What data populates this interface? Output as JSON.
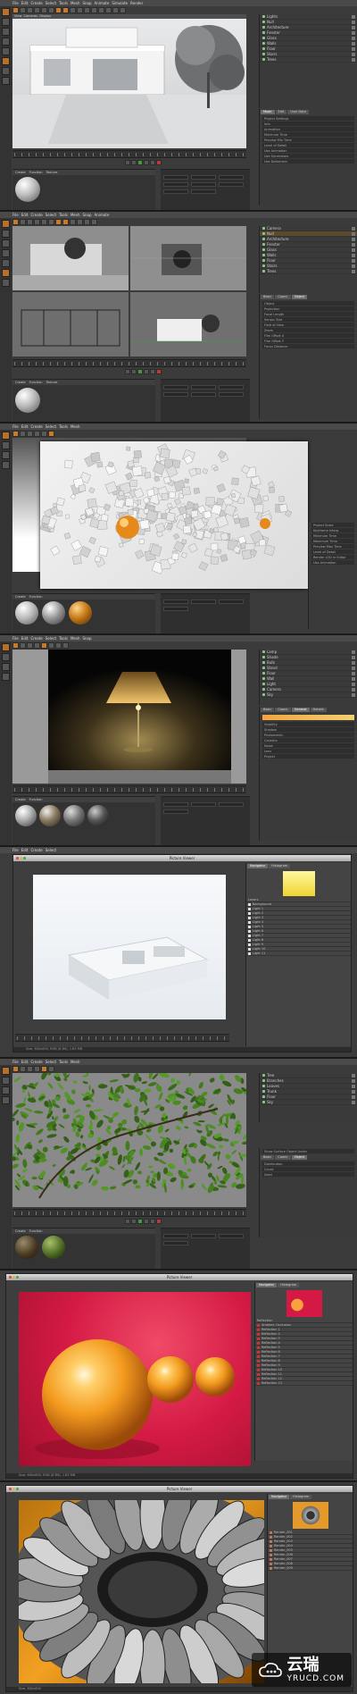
{
  "app": {
    "menu_items": [
      "File",
      "Edit",
      "Create",
      "Select",
      "Tools",
      "Mesh",
      "Snap",
      "Animate",
      "Simulate",
      "Render",
      "Sculpt",
      "Character",
      "Plugins",
      "Script",
      "Window",
      "Help"
    ],
    "viewport_menu": [
      "View",
      "Cameras",
      "Display",
      "Options",
      "Filter",
      "Panel"
    ],
    "material_menu": [
      "Create",
      "Function",
      "Texture"
    ],
    "attr_tabs": [
      "Mode",
      "Edit",
      "User Data"
    ],
    "object_tabs": [
      "Basic",
      "Coord.",
      "Object",
      "Phong"
    ]
  },
  "strips": [
    {
      "id": "s1",
      "objects": [
        "Lights",
        "Null",
        "Architecture",
        "Fenster",
        "Glass",
        "Walls",
        "Floor",
        "Stairs",
        "Trees"
      ],
      "fields": [
        "Project Settings",
        "Info",
        "Animation",
        "Minimum Time",
        "Preview Min Time",
        "Level of Detail",
        "Use Animation",
        "Use Generators",
        "Use Deformers"
      ],
      "frame": "0 F",
      "maxframe": "90 F"
    },
    {
      "id": "s2",
      "objects": [
        "Camera",
        "Null",
        "Architecture",
        "Fenster",
        "Glass",
        "Walls",
        "Floor",
        "Stairs",
        "Trees"
      ],
      "fields": [
        "Object",
        "Projection",
        "Focal Length",
        "Sensor Size",
        "Field of View",
        "Zoom",
        "Film Offset X",
        "Film Offset Y",
        "Focus Distance"
      ],
      "frame": "0 F",
      "maxframe": "90 F"
    },
    {
      "id": "s3",
      "objects": [
        "Camera",
        "Cubes",
        "Sphere",
        "Floor",
        "Light",
        "Sky"
      ],
      "fields": [
        "Project Scale",
        "Keyframe Interp.",
        "Minimum Time",
        "Maximum Time",
        "Preview Max Time",
        "Level of Detail",
        "Render LOD in Editor",
        "Use Animation"
      ],
      "frame": "0 F",
      "maxframe": "90 F"
    },
    {
      "id": "s4",
      "objects": [
        "Lamp",
        "Shade",
        "Bulb",
        "Stand",
        "Floor",
        "Wall",
        "Light",
        "Camera",
        "Sky"
      ],
      "fields": [
        "General",
        "Details",
        "Visibility",
        "Shadow",
        "Photometric",
        "Caustics",
        "Noise",
        "Lens",
        "Project"
      ],
      "frame": "0 F",
      "maxframe": "90 F"
    },
    {
      "id": "s5",
      "title": "Picture Viewer",
      "tabs": [
        "Navigator",
        "Histogram"
      ],
      "layers": [
        "Layers",
        "Background",
        "Light 1",
        "Light 2",
        "Light 3",
        "Light 4",
        "Light 5",
        "Light 6",
        "Light 7",
        "Light 8",
        "Light 9",
        "Light 10",
        "Light 11"
      ],
      "status": "Size: 800x600, RGB (8 Bit), 1.83 MB"
    },
    {
      "id": "s6",
      "objects": [
        "Tree",
        "Branches",
        "Leaves",
        "Trunk",
        "Floor",
        "Sky"
      ],
      "fields": [
        "Show Surface Object Under",
        "Basic",
        "Coord.",
        "Object",
        "Distribution",
        "Count",
        "Seed"
      ],
      "frame": "0 F",
      "maxframe": "90 F"
    },
    {
      "id": "s7",
      "title": "Picture Viewer",
      "tabs": [
        "Navigator",
        "Histogram"
      ],
      "layers": [
        "Reflection",
        "Ambient Occlusion",
        "Reflection 1",
        "Reflection 2",
        "Reflection 3",
        "Reflection 4",
        "Reflection 5",
        "Reflection 6",
        "Reflection 7",
        "Reflection 8",
        "Reflection 9",
        "Reflection 10",
        "Reflection 11",
        "Reflection 12",
        "Reflection 13"
      ],
      "status": "Size: 800x600, RGB (8 Bit), 1.83 MB"
    },
    {
      "id": "s8",
      "title": "Picture Viewer",
      "tabs": [
        "Navigator",
        "Histogram"
      ],
      "layers": [
        "Render_001",
        "Render_002",
        "Render_003",
        "Render_004",
        "Render_005",
        "Render_006",
        "Render_007",
        "Render_008",
        "Render_009"
      ],
      "status": "Size: 800x600"
    }
  ],
  "watermark": {
    "cn": "云瑞",
    "en": "YRUCD.COM"
  },
  "colors": {
    "accent": "#c77a2a",
    "bg": "#3b3b3b",
    "panel": "#3a3a3a"
  }
}
